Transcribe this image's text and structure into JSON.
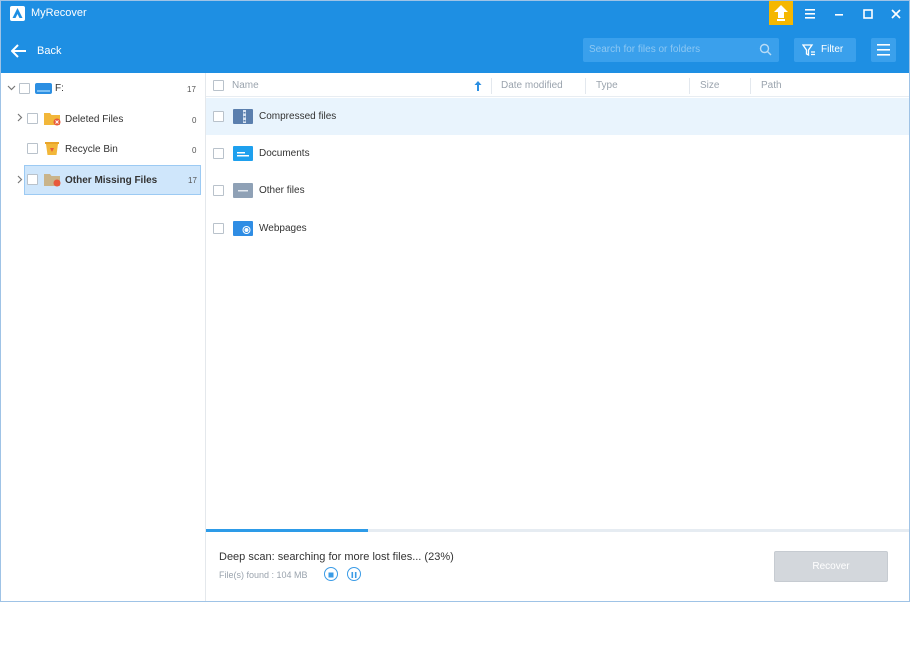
{
  "window": {
    "title": "MyRecover"
  },
  "toolbar": {
    "back_label": "Back",
    "search_placeholder": "Search for files or folders",
    "filter_label": "Filter"
  },
  "sidebar": {
    "root": {
      "label": "F:",
      "count": "17"
    },
    "items": [
      {
        "label": "Deleted Files",
        "count": "0"
      },
      {
        "label": "Recycle Bin",
        "count": "0"
      },
      {
        "label": "Other Missing Files",
        "count": "17"
      }
    ]
  },
  "columns": [
    "Name",
    "Date modified",
    "Type",
    "Size",
    "Path"
  ],
  "files": [
    {
      "name": "Compressed files",
      "icon": "archive-folder-icon"
    },
    {
      "name": "Documents",
      "icon": "document-folder-icon"
    },
    {
      "name": "Other files",
      "icon": "other-files-folder-icon"
    },
    {
      "name": "Webpages",
      "icon": "webpage-folder-icon"
    }
  ],
  "status": {
    "message": "Deep scan: searching for more lost files... (23%)",
    "found": "File(s) found : 104 MB",
    "progress": 0.23
  },
  "actions": {
    "recover_label": "Recover"
  },
  "colors": {
    "accent": "#1e8fe3",
    "selected": "#cfe6fb",
    "folder": "#f2b73a"
  }
}
